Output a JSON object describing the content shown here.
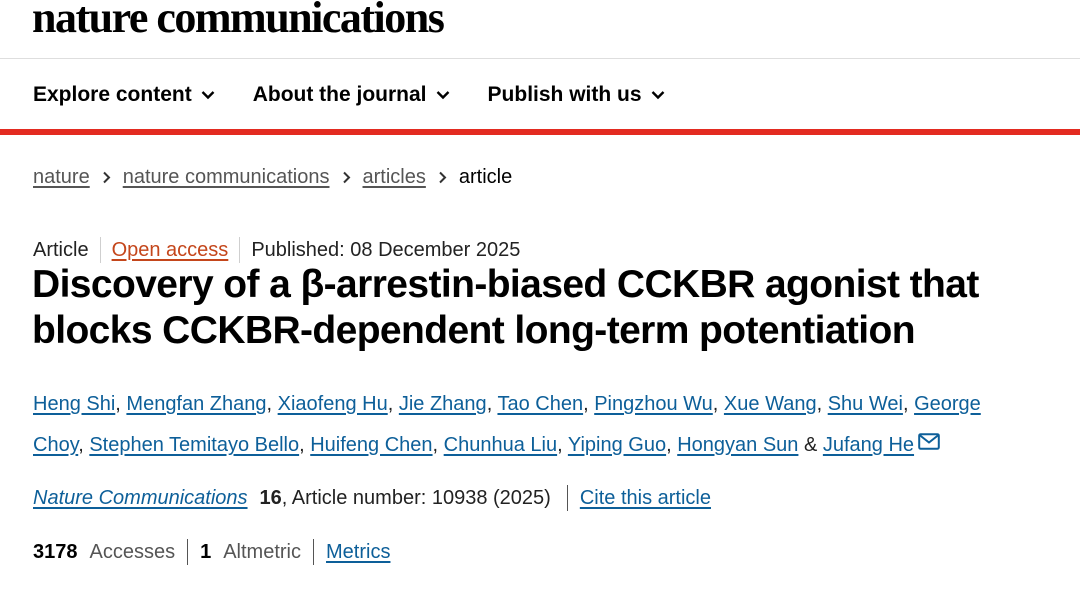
{
  "brand": "nature communications",
  "nav": [
    {
      "label": "Explore content"
    },
    {
      "label": "About the journal"
    },
    {
      "label": "Publish with us"
    }
  ],
  "breadcrumb": [
    "nature",
    "nature communications",
    "articles",
    "article"
  ],
  "meta": {
    "type": "Article",
    "access": "Open access",
    "published": "Published: 08 December 2025"
  },
  "title_line1": "Discovery of a β-arrestin-biased CCKBR agonist that",
  "title_line2": "blocks CCKBR-dependent long-term potentiation",
  "authors": [
    "Heng Shi",
    "Mengfan Zhang",
    "Xiaofeng Hu",
    "Jie Zhang",
    "Tao Chen",
    "Pingzhou Wu",
    "Xue Wang",
    "Shu Wei",
    "George Choy",
    "Stephen Temitayo Bello",
    "Huifeng Chen",
    "Chunhua Liu",
    "Yiping Guo",
    "Hongyan Sun",
    "Jufang He"
  ],
  "citation": {
    "journal": "Nature Communications",
    "volume": "16",
    "article_number": ", Article number: 10938 (2025)",
    "cite_link": "Cite this article"
  },
  "metrics": {
    "accesses_count": "3178",
    "accesses_label": "Accesses",
    "altmetric_count": "1",
    "altmetric_label": "Altmetric",
    "metrics_link": "Metrics"
  },
  "colors": {
    "brand_red": "#e32b21",
    "link_blue": "#0d5f99",
    "open_access_orange": "#c4461b"
  }
}
